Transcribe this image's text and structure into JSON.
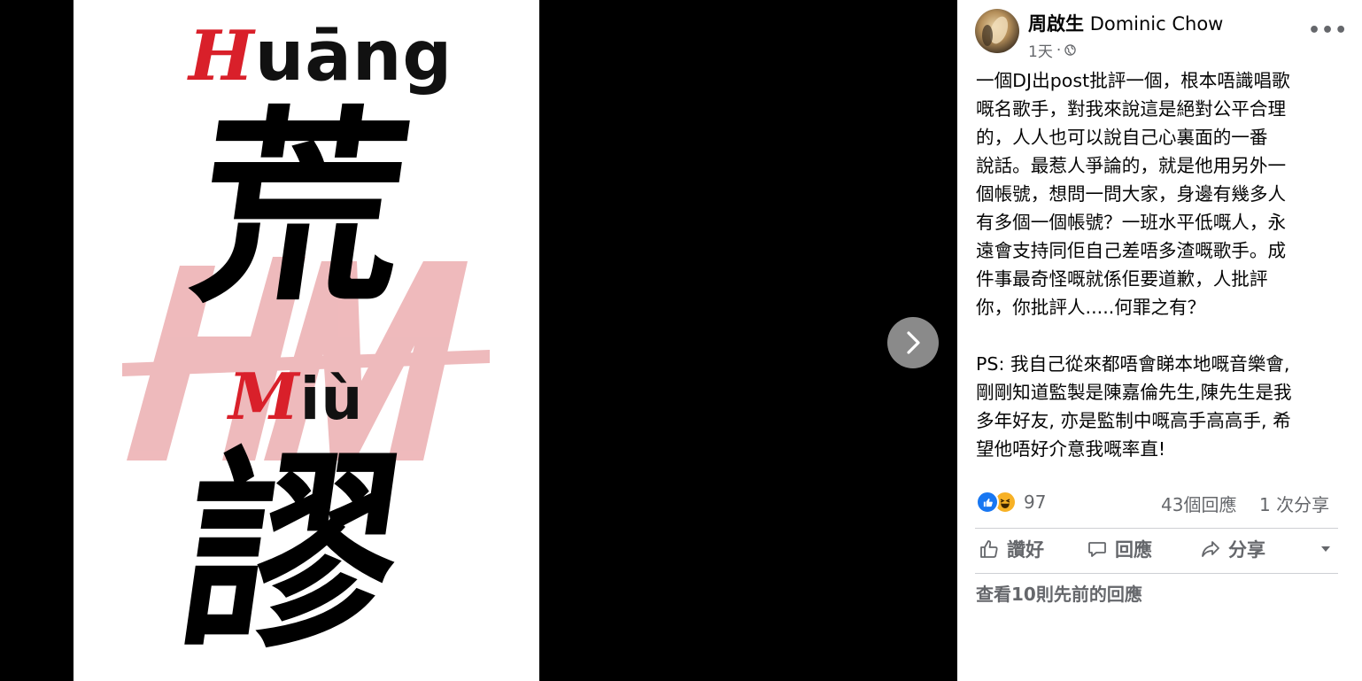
{
  "poster": {
    "pinyin_top_cap": "H",
    "pinyin_top_rest": "uāng",
    "char_top": "荒",
    "pinyin_bottom_cap": "M",
    "pinyin_bottom_rest": "iù",
    "char_bottom": "謬",
    "watermark": "HM"
  },
  "post": {
    "author_zh": "周啟生",
    "author_en": "Dominic Chow",
    "time": "1天",
    "separator": "·",
    "more_label": "•••",
    "text": "一個DJ出post批評一個，根本唔識唱歌\n嘅名歌手，對我來說這是絕對公平合理\n的，￼人人也可以說自己心裏面的一番\n說話。最惹人爭論的，就是他用另外一\n個帳號，想問一問大家，身邊有幾多人\n有多個一個帳號？一班水平低嘅人，永\n遠會支持同佢自己差唔多渣嘅歌手。成\n件事最奇怪嘅就係佢要道歉，人批評\n你，你批評人.....何罪之有？\n\nPS: 我自己從來都唔會睇本地嘅音樂會,\n剛剛知道監製是陳嘉倫先生,陳先生是我\n多年好友, 亦是監制中嘅高手高高手, 希\n望他唔好介意我嘅率直!",
    "reaction_count": "97",
    "comments": "43個回應",
    "shares": "1 次分享",
    "like_label": "讚好",
    "comment_label": "回應",
    "share_label": "分享",
    "view_previous": "查看10則先前的回應"
  },
  "colors": {
    "accent_red": "#d9202a",
    "like_blue": "#1877f2",
    "muted": "#65676b"
  },
  "icons": [
    "chevron-right-icon",
    "globe-icon",
    "like-reaction-icon",
    "haha-reaction-icon",
    "thumbs-up-icon",
    "comment-icon",
    "share-icon",
    "caret-down-icon",
    "more-icon"
  ]
}
